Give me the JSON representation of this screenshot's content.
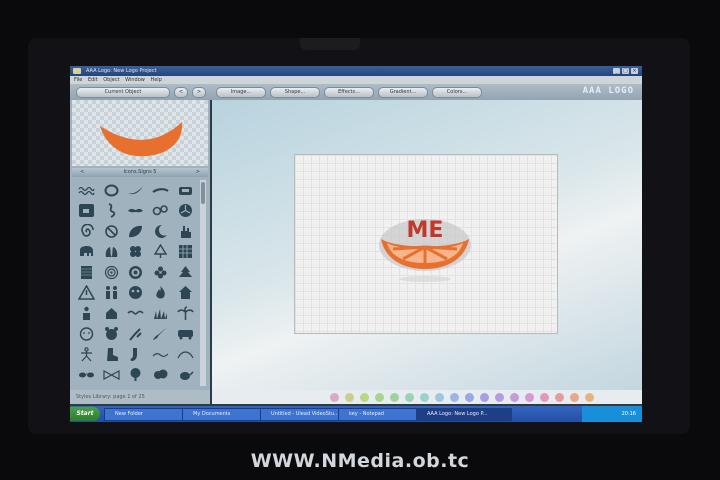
{
  "window": {
    "title": "AAA Logo: New Logo Project",
    "buttons": [
      "_",
      "□",
      "×"
    ]
  },
  "menu": [
    "File",
    "Edit",
    "Object",
    "Window",
    "Help"
  ],
  "toolbar": {
    "current_object": "Current Object",
    "prev_label": "<",
    "next_label": ">",
    "image": "Image...",
    "shape": "Shape...",
    "effects": "Effects...",
    "gradient": "Gradient...",
    "colors": "Colors...",
    "brand": "AAA LOGO"
  },
  "library": {
    "header": "Icons.Signs 5",
    "footer": "Styles Library: page 1 of 25",
    "prev": "<",
    "next": ">"
  },
  "logo": {
    "text": "ME",
    "text_color": "#c0392b",
    "fruit_color": "#e8702f"
  },
  "swatches": [
    "#d9a9c6",
    "#c9d08a",
    "#b9d87f",
    "#a9d68b",
    "#9fd39d",
    "#9ad4b6",
    "#9bd2cd",
    "#9cc7de",
    "#9bb6e5",
    "#9aa8e6",
    "#a69fe2",
    "#b49ee0",
    "#c49cdc",
    "#d59bd0",
    "#e09ab8",
    "#e59c9c",
    "#e6a98a",
    "#e5b47e"
  ],
  "taskbar": {
    "start": "Start",
    "tasks": [
      "New Folder",
      "My Documents",
      "Untitled - Ulead VideoStu...",
      "key - Notepad",
      "AAA Logo: New Logo P..."
    ],
    "clock": "20:16"
  },
  "watermark": "WWW.NMedia.ob.tc"
}
